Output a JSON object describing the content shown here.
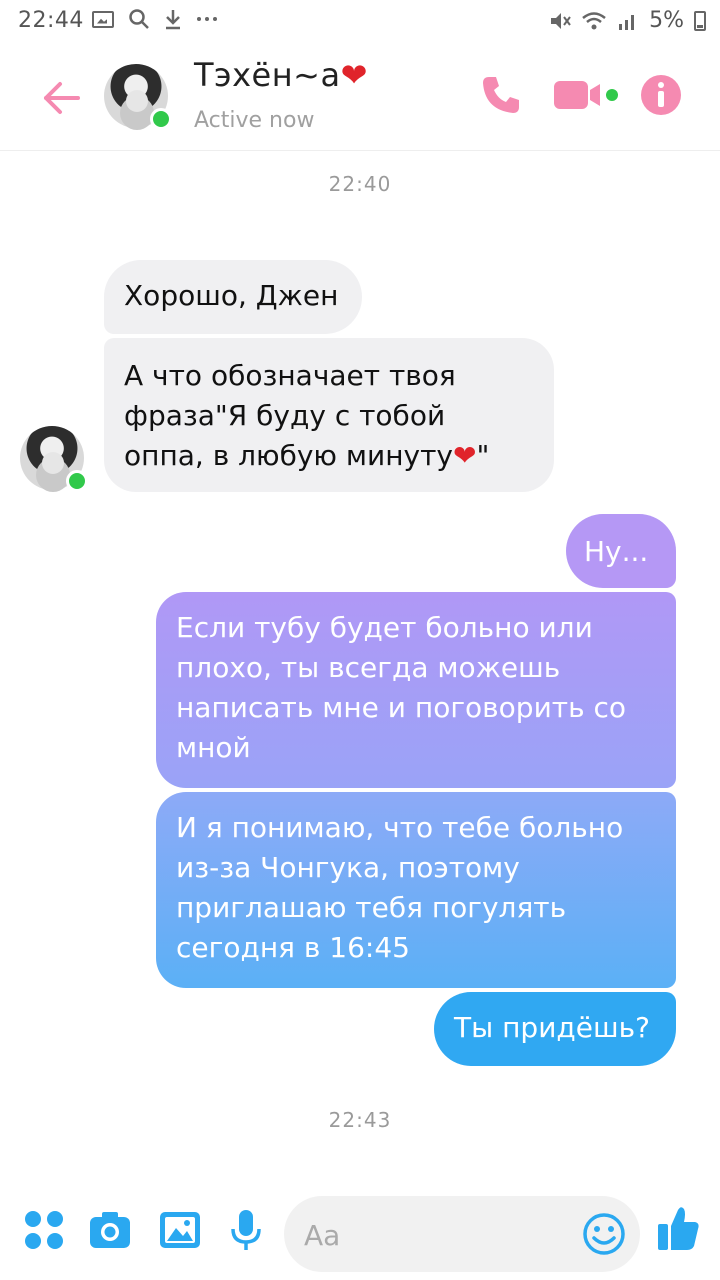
{
  "status_bar": {
    "time": "22:44",
    "battery": "5%",
    "icons": [
      "gallery-icon",
      "search-icon",
      "download-icon",
      "more-icon",
      "mute-icon",
      "wifi-icon",
      "signal-icon",
      "battery-icon"
    ]
  },
  "header": {
    "contact_name": "Тэхён~а",
    "contact_name_suffix": "❤",
    "status": "Active now",
    "accent_color": "#f58ab1"
  },
  "timestamps": [
    "22:40",
    "22:43"
  ],
  "messages": [
    {
      "direction": "incoming",
      "text": "Хорошо, Джен"
    },
    {
      "direction": "incoming",
      "line1": "А что обозначает твоя",
      "line2": "фраза\"Я буду с тобой",
      "line3": "оппа, в любую минуту",
      "heart": "❤",
      "end_quote": "\""
    },
    {
      "direction": "outgoing",
      "text": "Ну..."
    },
    {
      "direction": "outgoing",
      "text": "Если тубу будет больно или плохо, ты всегда можешь написать мне и поговорить со мной"
    },
    {
      "direction": "outgoing",
      "text": "И я понимаю, что тебе больно из-за Чонгука, поэтому приглашаю тебя погулять сегодня в 16:45"
    },
    {
      "direction": "outgoing",
      "text": "Ты придёшь?"
    }
  ],
  "composer": {
    "placeholder": "Aa"
  },
  "colors": {
    "incoming_bubble": "#f0f0f2",
    "outgoing_gradient_top": "#b598f5",
    "outgoing_gradient_bottom": "#2ea8f2",
    "toolbar_icons": "#2aa8f0",
    "online": "#31c94b"
  }
}
